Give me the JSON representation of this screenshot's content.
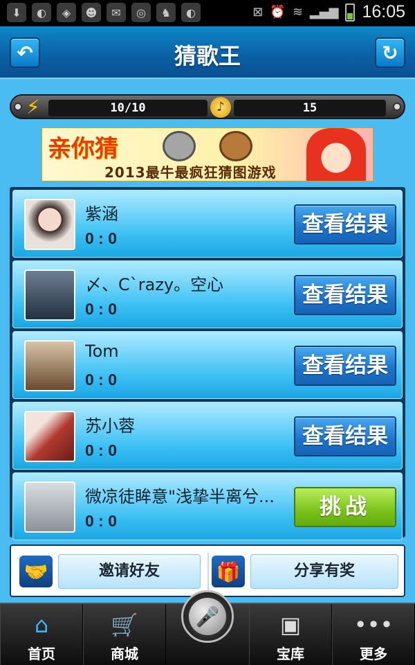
{
  "status_bar": {
    "time": "16:05",
    "left_icons": [
      "download-icon",
      "leaf-app-icon",
      "wifi-shield-icon",
      "avatar-app-icon",
      "mail-icon",
      "browser-icon",
      "android-icon",
      "leaf-app-icon-2"
    ],
    "right_icons": [
      "no-sim-icon",
      "alarm-icon",
      "wifi-icon",
      "signal-icon",
      "battery-icon"
    ]
  },
  "header": {
    "title": "猜歌王",
    "back_icon": "back-arrow-icon",
    "refresh_icon": "refresh-icon"
  },
  "stats": {
    "energy": "10/10",
    "coins": "15"
  },
  "banner": {
    "title": "亲你猜",
    "subtitle": "2013最牛最疯狂猜图游戏"
  },
  "friends": [
    {
      "name": "紫涵",
      "score": "0 : 0",
      "action": "查看结果",
      "action_type": "view"
    },
    {
      "name": "〆、C`razy。空心",
      "score": "0 : 0",
      "action": "查看结果",
      "action_type": "view"
    },
    {
      "name": "Tom",
      "score": "0 : 0",
      "action": "查看结果",
      "action_type": "view"
    },
    {
      "name": "苏小蓉",
      "score": "0 : 0",
      "action": "查看结果",
      "action_type": "view"
    },
    {
      "name": "微凉徒眸意\"浅挚半离兮...",
      "score": "0 : 0",
      "action": "挑战",
      "action_type": "challenge"
    }
  ],
  "tools": {
    "invite_label": "邀请好友",
    "share_label": "分享有奖"
  },
  "bottom_nav": {
    "home": "首页",
    "shop": "商城",
    "vault": "宝库",
    "more": "更多"
  },
  "colors": {
    "background": "#4bbcf2",
    "header": "#0b62a6",
    "view_button": "#1c72c8",
    "challenge_button": "#7ac21a"
  }
}
